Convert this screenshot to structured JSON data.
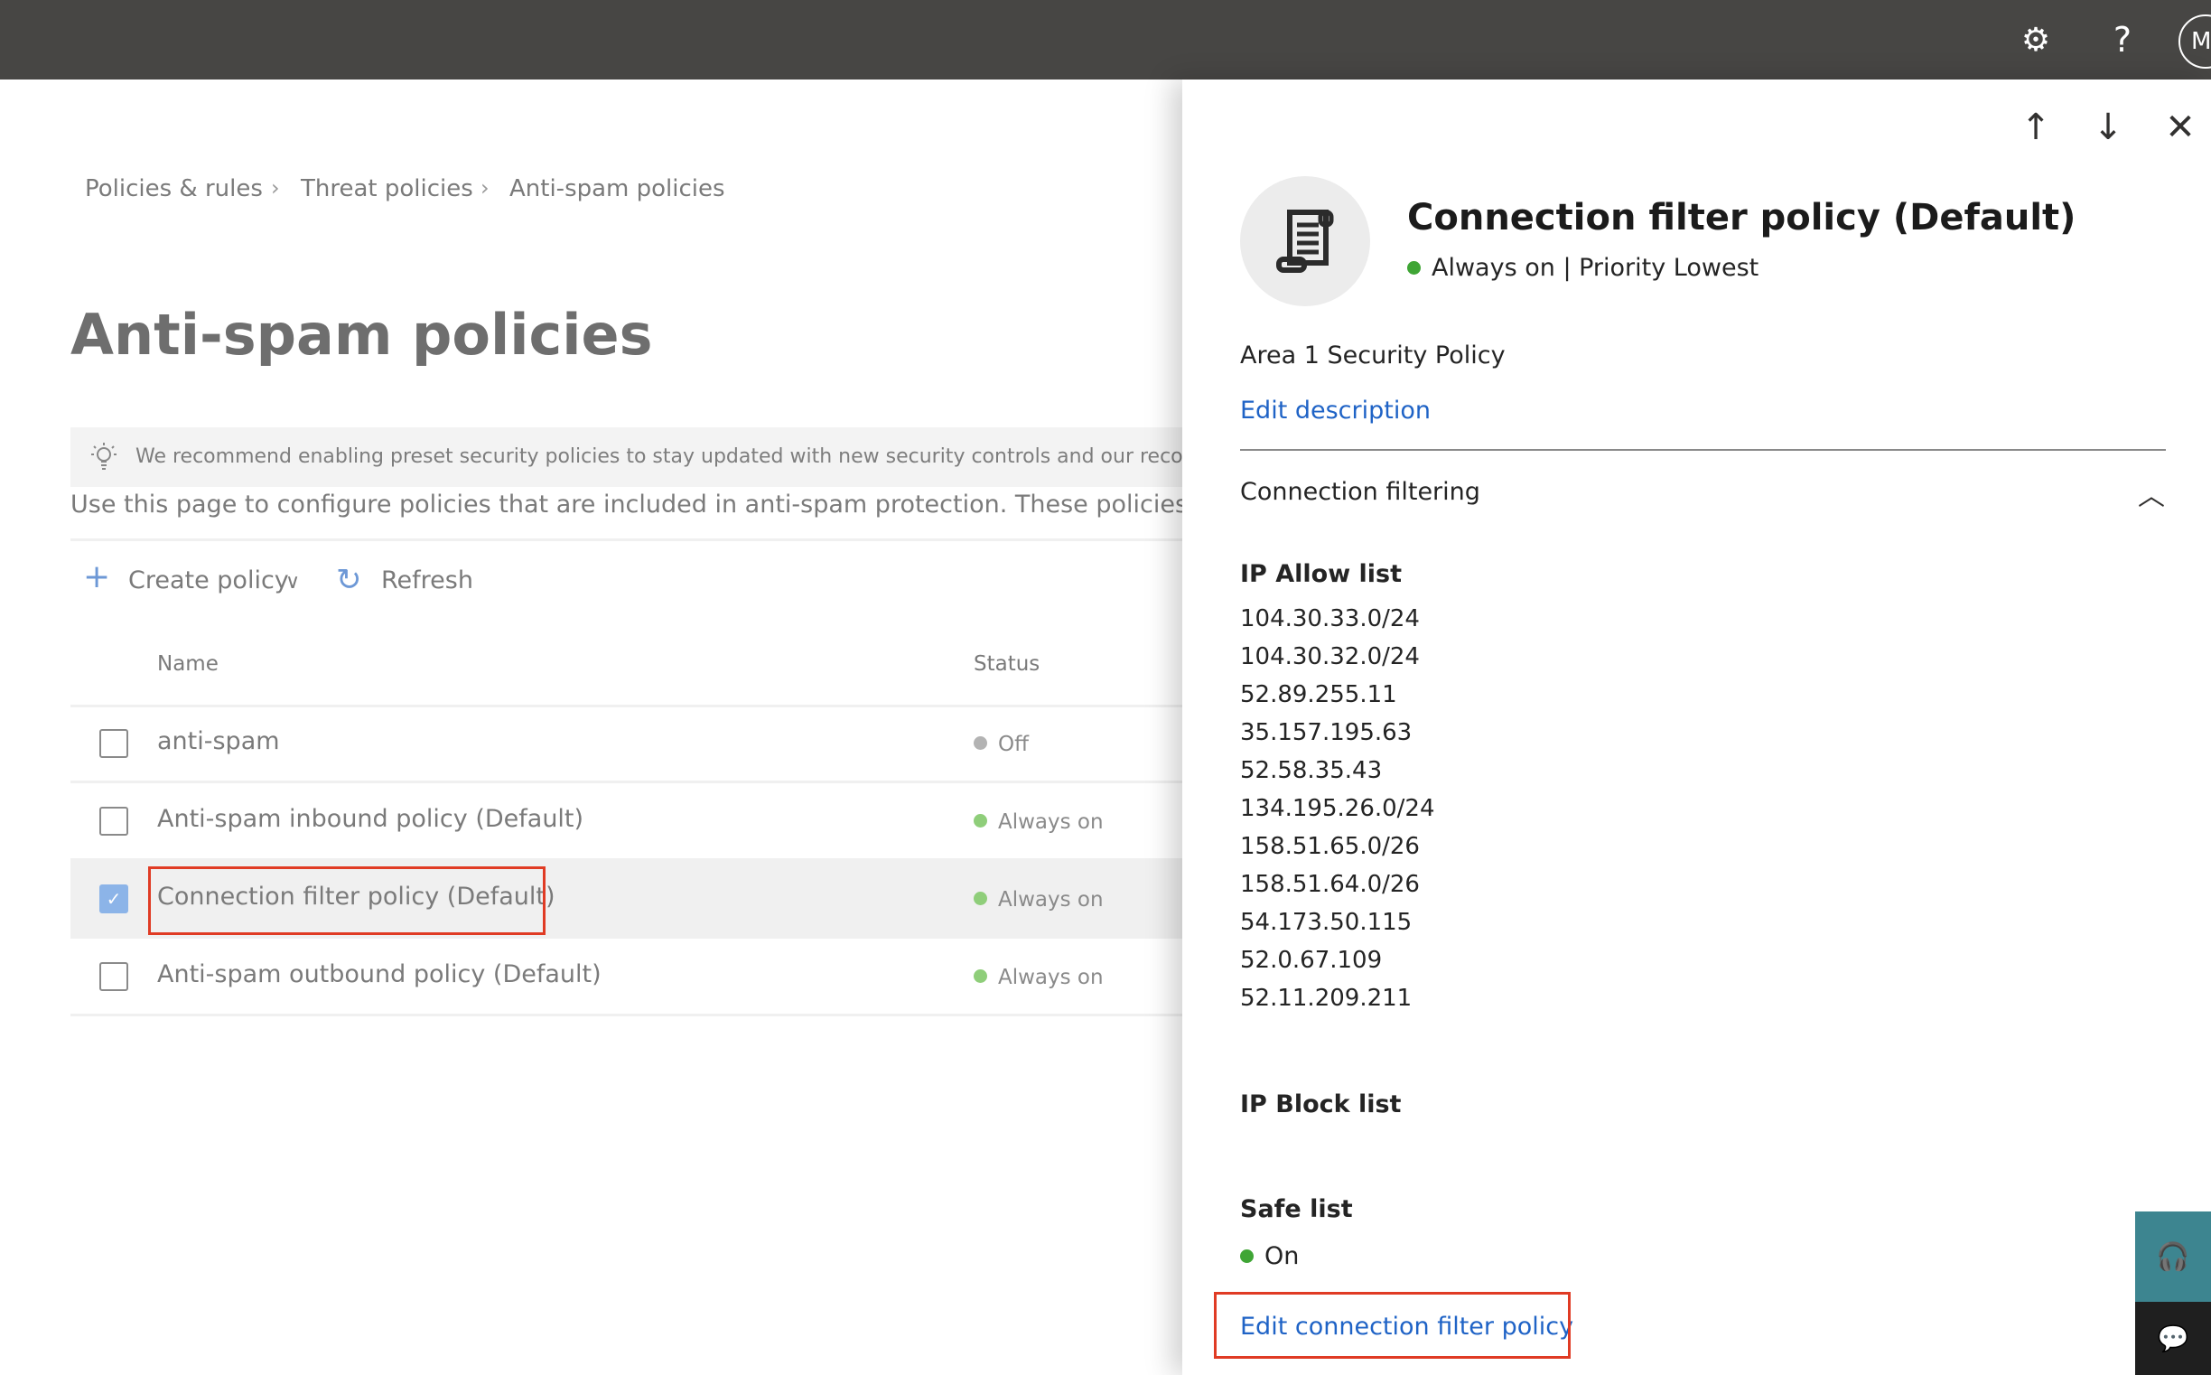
{
  "topbar": {
    "settings_icon": "gear-icon",
    "help_icon": "question-icon",
    "avatar_initial": "M"
  },
  "breadcrumb": [
    "Policies & rules",
    "Threat policies",
    "Anti-spam policies"
  ],
  "page_title": "Anti-spam policies",
  "banner": {
    "icon": "lightbulb-icon",
    "text": "We recommend enabling preset security policies to stay updated with new security controls and our recommended settings."
  },
  "description": "Use this page to configure policies that are included in anti-spam protection. These policies include connection filtering, spam filtering, outbound spam filtering, and the ability to spoof.",
  "toolbar": {
    "create": "Create policy",
    "refresh": "Refresh"
  },
  "table": {
    "columns": [
      "Name",
      "Status"
    ],
    "rows": [
      {
        "name": "anti-spam",
        "status": "Off",
        "selected": false,
        "status_color": "#b3b3b3"
      },
      {
        "name": "Anti-spam inbound policy (Default)",
        "status": "Always on",
        "selected": false,
        "status_color": "#8fce7a"
      },
      {
        "name": "Connection filter policy (Default)",
        "status": "Always on",
        "selected": true,
        "status_color": "#8fce7a"
      },
      {
        "name": "Anti-spam outbound policy (Default)",
        "status": "Always on",
        "selected": false,
        "status_color": "#8fce7a"
      }
    ]
  },
  "panel": {
    "title": "Connection filter policy (Default)",
    "subtitle": "Always on | Priority Lowest",
    "description": "Area 1 Security Policy",
    "edit_description": "Edit description",
    "section": "Connection filtering",
    "ip_allow_label": "IP Allow list",
    "ip_allow": [
      "104.30.33.0/24",
      "104.30.32.0/24",
      "52.89.255.11",
      "35.157.195.63",
      "52.58.35.43",
      "134.195.26.0/24",
      "158.51.65.0/26",
      "158.51.64.0/26",
      "54.173.50.115",
      "52.0.67.109",
      "52.11.209.211"
    ],
    "ip_block_label": "IP Block list",
    "safe_list_label": "Safe list",
    "safe_list_value": "On",
    "edit_link": "Edit connection filter policy"
  },
  "colors": {
    "accent": "#1f63c6",
    "highlight": "#e03b24",
    "status_on": "#3fa535"
  }
}
